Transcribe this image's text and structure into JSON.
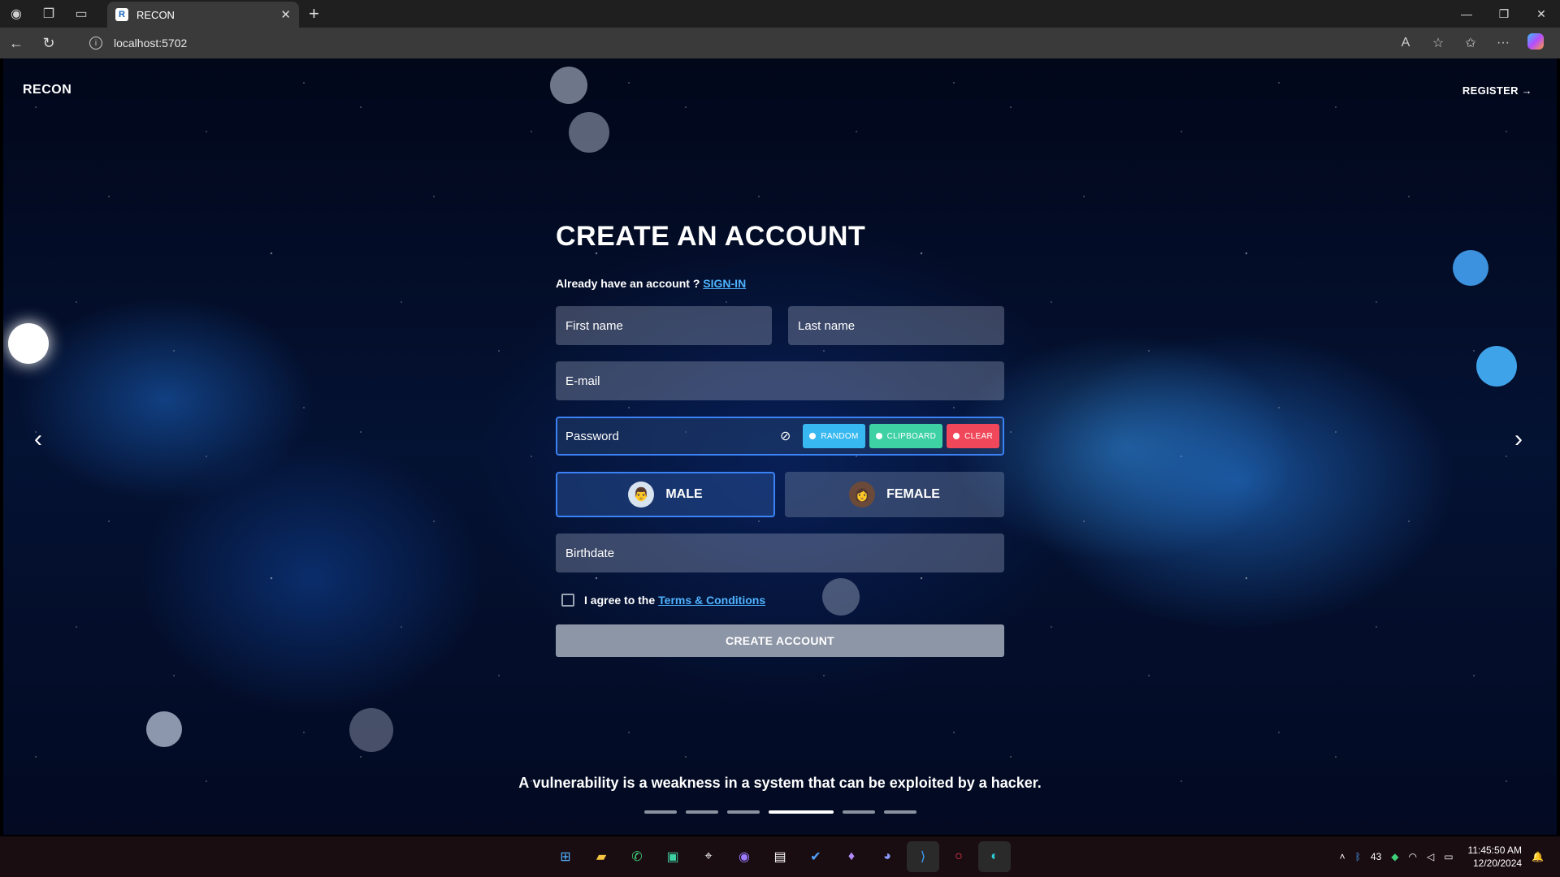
{
  "browser": {
    "tab_title": "RECON",
    "url": "localhost:5702"
  },
  "header": {
    "brand": "RECON",
    "register": "REGISTER →"
  },
  "form": {
    "title": "CREATE AN ACCOUNT",
    "already_text": "Already have an account ?",
    "signin_link": "SIGN-IN",
    "first_name_placeholder": "First name",
    "last_name_placeholder": "Last name",
    "email_placeholder": "E-mail",
    "password_placeholder": "Password",
    "random_label": "RANDOM",
    "clipboard_label": "CLIPBOARD",
    "clear_label": "CLEAR",
    "male_label": "MALE",
    "female_label": "FEMALE",
    "selected_gender": "MALE",
    "birthdate_placeholder": "Birthdate",
    "agree_text": "I agree to the",
    "terms_link": "Terms & Conditions",
    "create_button": "CREATE ACCOUNT"
  },
  "slider": {
    "quote": "A vulnerability is a weakness in a system that can be exploited by a hacker.",
    "active_index": 3,
    "count": 6
  },
  "taskbar": {
    "time": "11:45:50 AM",
    "date": "12/20/2024",
    "badge": "43"
  },
  "colors": {
    "accent": "#3b82f6",
    "link": "#4fb3ff",
    "random": "#38b8f0",
    "clipboard": "#3ed1a3",
    "clear": "#f0485a"
  }
}
